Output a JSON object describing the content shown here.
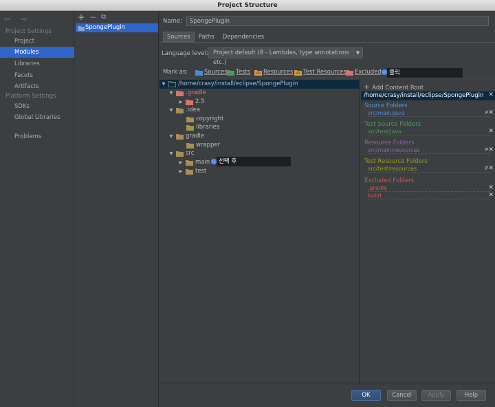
{
  "window": {
    "title": "Project Structure"
  },
  "nav": {
    "arrows": "⇦ ⇨",
    "project_settings_header": "Project Settings",
    "project_settings": [
      "Project",
      "Modules",
      "Libraries",
      "Facets",
      "Artifacts"
    ],
    "platform_settings_header": "Platform Settings",
    "platform_settings": [
      "SDKs",
      "Global Libraries"
    ],
    "problems": "Problems",
    "selected": "Modules"
  },
  "modules": {
    "toolbar": {
      "add": "+",
      "remove": "−",
      "copy": "⧉"
    },
    "items": [
      "SpongePlugin"
    ]
  },
  "module": {
    "name_label": "Name:",
    "name_value": "SpongePlugin",
    "tabs": [
      "Sources",
      "Paths",
      "Dependencies"
    ],
    "active_tab": "Sources",
    "language_level_label": "Language level:",
    "language_level_value": "Project default (8 - Lambdas, type annotations etc.)",
    "mark_as_label": "Mark as:",
    "mark_as_options": [
      "Sources",
      "Tests",
      "Resources",
      "Test Resources",
      "Excluded"
    ],
    "annotation_click": "클릭",
    "annotation_select": "선택 후"
  },
  "tree": {
    "root": "/home/crasy/install/eclipse/SpongePlugin",
    "gradle_hidden": ".gradle",
    "gradle_version": "2.5",
    "idea": ".idea",
    "copyright": "copyright",
    "libraries": "libraries",
    "gradle": "gradle",
    "wrapper": "wrapper",
    "src": "src",
    "main": "main",
    "test": "test"
  },
  "roots": {
    "add_content_root": "Add Content Root",
    "path": "/home/crasy/install/eclipse/SpongePlugin",
    "source_header": "Source Folders",
    "source_value": "src/main/java",
    "test_header": "Test Source Folders",
    "test_value": "src/test/java",
    "resource_header": "Resource Folders",
    "resource_value": "src/main/resources",
    "test_resource_header": "Test Resource Folders",
    "test_resource_value": "src/test/resources",
    "excluded_header": "Excluded Folders",
    "excluded_values": [
      ".gradle",
      "build"
    ],
    "props_glyph": "P",
    "close_glyph": "✕"
  },
  "buttons": {
    "ok": "OK",
    "cancel": "Cancel",
    "apply": "Apply",
    "help": "Help"
  },
  "colors": {
    "selection": "#2f65ca",
    "source": "#5c93dc",
    "test": "#4c9c57",
    "resource": "#8c66a7",
    "test_resource": "#9a9a1e",
    "excluded": "#d2554c"
  }
}
